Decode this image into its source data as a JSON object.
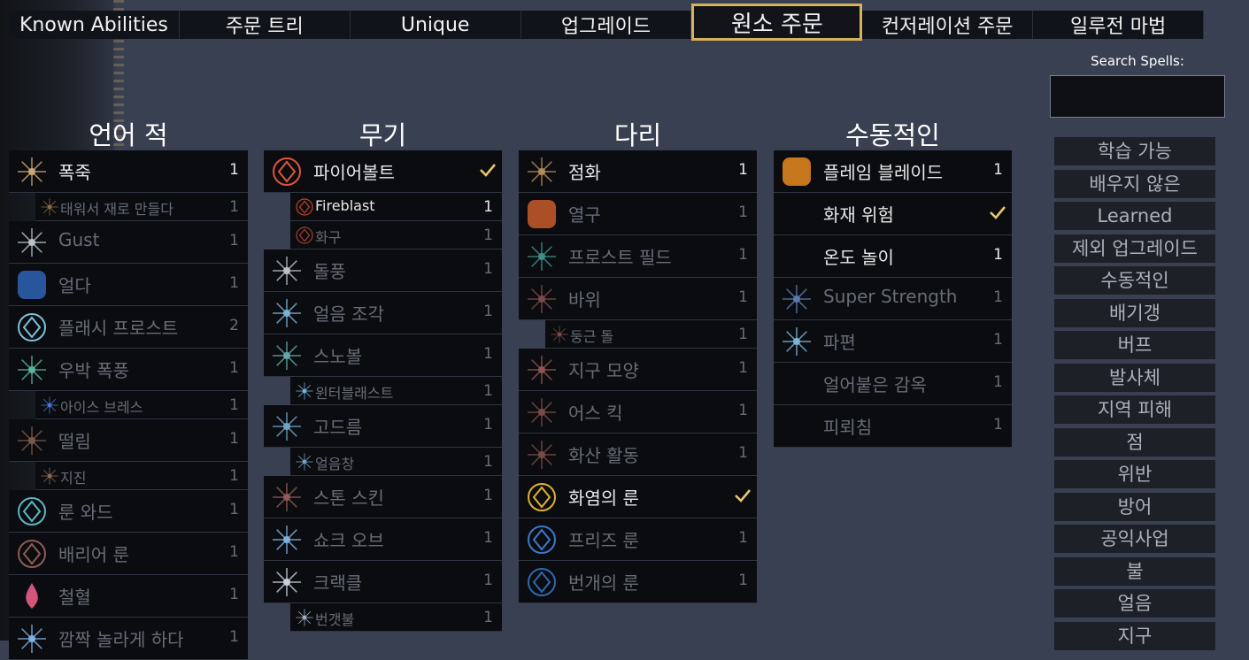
{
  "tabs": [
    "Known Abilities",
    "주문 트리",
    "Unique",
    "업그레이드",
    "원소 주문",
    "컨저레이션 주문",
    "일루전 마법"
  ],
  "active_tab": "원소 주문",
  "search": {
    "label": "Search Spells:",
    "value": ""
  },
  "columns": [
    {
      "title": "언어 적",
      "rows": [
        {
          "label": "폭죽",
          "count": "1",
          "dim": false,
          "sub": false,
          "icon": "sparkle-icon",
          "color": "#c8a874"
        },
        {
          "label": "태워서 재로 만들다",
          "count": "1",
          "dim": true,
          "sub": true,
          "icon": "torch-icon",
          "color": "#8c6c40"
        },
        {
          "label": "Gust",
          "count": "1",
          "dim": true,
          "sub": false,
          "icon": "wind-icon",
          "color": "#b9c1c9"
        },
        {
          "label": "얼다",
          "count": "1",
          "dim": true,
          "sub": false,
          "icon": "ice-block-icon",
          "color": "#2f63b5"
        },
        {
          "label": "플래시 프로스트",
          "count": "2",
          "dim": true,
          "sub": false,
          "icon": "frost-rune-icon",
          "color": "#7ec0d9"
        },
        {
          "label": "우박 폭풍",
          "count": "1",
          "dim": true,
          "sub": false,
          "icon": "hail-icon",
          "color": "#57b4a0"
        },
        {
          "label": "아이스 브레스",
          "count": "1",
          "dim": true,
          "sub": true,
          "icon": "ice-crystal-icon",
          "color": "#4a78d3"
        },
        {
          "label": "떨림",
          "count": "1",
          "dim": true,
          "sub": false,
          "icon": "tremor-icon",
          "color": "#7a5a44"
        },
        {
          "label": "지진",
          "count": "1",
          "dim": true,
          "sub": true,
          "icon": "quake-icon",
          "color": "#8a6a52"
        },
        {
          "label": "룬 와드",
          "count": "1",
          "dim": true,
          "sub": false,
          "icon": "rune-ward-icon",
          "color": "#5ab8c4"
        },
        {
          "label": "배리어 룬",
          "count": "1",
          "dim": true,
          "sub": false,
          "icon": "barrier-rune-icon",
          "color": "#8e5c54"
        },
        {
          "label": "철혈",
          "count": "1",
          "dim": true,
          "sub": false,
          "icon": "blood-drop-icon",
          "color": "#d4547a"
        },
        {
          "label": "깜짝 놀라게 하다",
          "count": "1",
          "dim": true,
          "sub": false,
          "icon": "shock-icon",
          "color": "#7fb0e0"
        }
      ]
    },
    {
      "title": "무기",
      "rows": [
        {
          "label": "파이어볼트",
          "count": "",
          "check": true,
          "dim": false,
          "sub": false,
          "icon": "firebolt-icon",
          "color": "#e0553a"
        },
        {
          "label": "Fireblast",
          "count": "1",
          "dim": false,
          "sub": true,
          "icon": "fireblast-icon",
          "color": "#c0442e"
        },
        {
          "label": "화구",
          "count": "1",
          "dim": true,
          "sub": true,
          "icon": "fireball-icon",
          "color": "#a0402e"
        },
        {
          "label": "돌풍",
          "count": "1",
          "dim": true,
          "sub": false,
          "icon": "gust-icon",
          "color": "#b9c1c9"
        },
        {
          "label": "얼음 조각",
          "count": "1",
          "dim": true,
          "sub": false,
          "icon": "ice-shard-icon",
          "color": "#7ab3d6"
        },
        {
          "label": "스노볼",
          "count": "1",
          "dim": true,
          "sub": false,
          "icon": "snowball-icon",
          "color": "#5fa8a4"
        },
        {
          "label": "윈터블래스트",
          "count": "1",
          "dim": true,
          "sub": true,
          "icon": "winterblast-icon",
          "color": "#6fb5e0"
        },
        {
          "label": "고드름",
          "count": "1",
          "dim": true,
          "sub": false,
          "icon": "icicle-icon",
          "color": "#6fa6c6"
        },
        {
          "label": "얼음창",
          "count": "1",
          "dim": true,
          "sub": true,
          "icon": "ice-spear-icon",
          "color": "#6fa6c6"
        },
        {
          "label": "스톤 스킨",
          "count": "1",
          "dim": true,
          "sub": false,
          "icon": "stone-skin-icon",
          "color": "#8e5c54"
        },
        {
          "label": "쇼크 오브",
          "count": "1",
          "dim": true,
          "sub": false,
          "icon": "shock-orb-icon",
          "color": "#7fb0e0"
        },
        {
          "label": "크랙클",
          "count": "1",
          "dim": true,
          "sub": false,
          "icon": "crackle-icon",
          "color": "#c9d0dc"
        },
        {
          "label": "번갯불",
          "count": "1",
          "dim": true,
          "sub": true,
          "icon": "lightning-icon",
          "color": "#9fb0c6"
        }
      ]
    },
    {
      "title": "다리",
      "rows": [
        {
          "label": "점화",
          "count": "1",
          "dim": false,
          "sub": false,
          "icon": "ignite-icon",
          "color": "#b48a5a"
        },
        {
          "label": "열구",
          "count": "1",
          "dim": true,
          "sub": false,
          "icon": "heat-orb-icon",
          "color": "#c75c2a"
        },
        {
          "label": "프로스트 필드",
          "count": "1",
          "dim": true,
          "sub": false,
          "icon": "frost-field-icon",
          "color": "#3e8f8a"
        },
        {
          "label": "바위",
          "count": "1",
          "dim": true,
          "sub": false,
          "icon": "boulder-icon",
          "color": "#7a4a48"
        },
        {
          "label": "둥근 돌",
          "count": "1",
          "dim": true,
          "sub": true,
          "icon": "round-stone-icon",
          "color": "#7a4a48"
        },
        {
          "label": "지구 모양",
          "count": "1",
          "dim": true,
          "sub": false,
          "icon": "earth-shape-icon",
          "color": "#8e5450"
        },
        {
          "label": "어스 킥",
          "count": "1",
          "dim": true,
          "sub": false,
          "icon": "earth-kick-icon",
          "color": "#7a4a48"
        },
        {
          "label": "화산 활동",
          "count": "1",
          "dim": true,
          "sub": false,
          "icon": "volcano-icon",
          "color": "#7a4a48"
        },
        {
          "label": "화염의 룬",
          "count": "",
          "check": true,
          "dim": false,
          "sub": false,
          "icon": "fire-rune-icon",
          "color": "#e0b030"
        },
        {
          "label": "프리즈 룬",
          "count": "1",
          "dim": true,
          "sub": false,
          "icon": "freeze-rune-icon",
          "color": "#3a7ac8"
        },
        {
          "label": "번개의 룬",
          "count": "1",
          "dim": true,
          "sub": false,
          "icon": "lightning-rune-icon",
          "color": "#2a6ab0"
        }
      ]
    },
    {
      "title": "수동적인",
      "rows": [
        {
          "label": "플레임 블레이드",
          "count": "1",
          "dim": false,
          "sub": false,
          "icon": "flame-blade-icon",
          "color": "#e88a20"
        },
        {
          "label": "화재 위험",
          "count": "",
          "check": true,
          "dim": false,
          "sub": false,
          "icon": "",
          "color": ""
        },
        {
          "label": "온도 놀이",
          "count": "1",
          "dim": false,
          "sub": false,
          "icon": "",
          "color": ""
        },
        {
          "label": "Super Strength",
          "count": "1",
          "dim": true,
          "sub": false,
          "icon": "strength-icon",
          "color": "#5a7ab0"
        },
        {
          "label": "파편",
          "count": "1",
          "dim": true,
          "sub": false,
          "icon": "shard-burst-icon",
          "color": "#7ab3d6"
        },
        {
          "label": "얼어붙은 감옥",
          "count": "1",
          "dim": true,
          "sub": false,
          "icon": "",
          "color": ""
        },
        {
          "label": "피뢰침",
          "count": "1",
          "dim": true,
          "sub": false,
          "icon": "",
          "color": ""
        }
      ]
    }
  ],
  "filters": [
    "학습 가능",
    "배우지 않은",
    "Learned",
    "제외 업그레이드",
    "수동적인",
    "배기갱",
    "버프",
    "발사체",
    "지역 피해",
    "점",
    "위반",
    "방어",
    "공익사업",
    "불",
    "얼음",
    "지구"
  ],
  "colors": {
    "accent_gold": "#d6b25d",
    "check": "#e8c86a",
    "background": "#394052"
  }
}
